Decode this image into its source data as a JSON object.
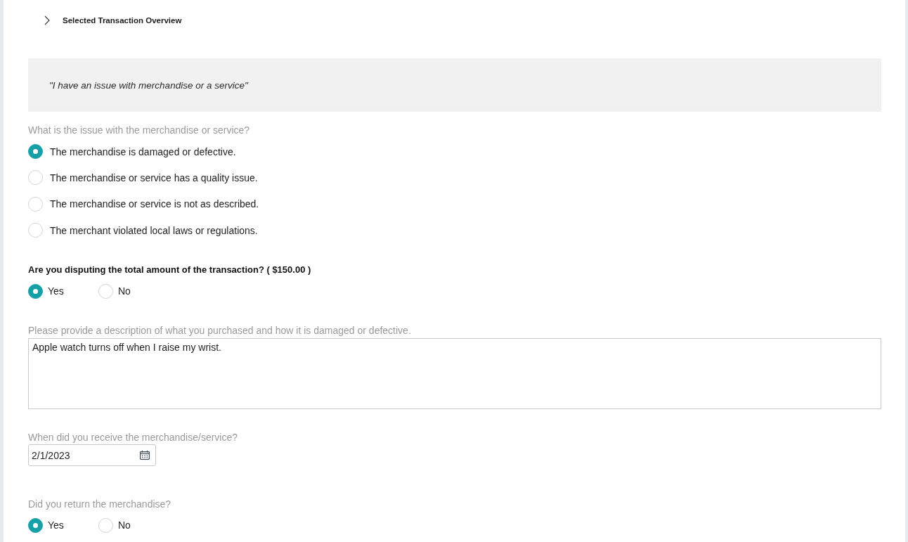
{
  "overview": {
    "title": "Selected Transaction Overview",
    "expanded": false
  },
  "claim_quote": "\"I have an issue with merchandise or a service\"",
  "questions": [
    {
      "kind": "radio_list",
      "label": "What is the issue with the merchandise or service?",
      "label_bold": false,
      "options": [
        {
          "label": "The merchandise is damaged or defective.",
          "selected": true
        },
        {
          "label": "The merchandise or service has a quality issue.",
          "selected": false
        },
        {
          "label": "The merchandise or service is not as described.",
          "selected": false
        },
        {
          "label": "The merchant violated local laws or regulations.",
          "selected": false
        }
      ]
    },
    {
      "kind": "radio_row",
      "label": "Are you disputing the total amount of the transaction? ( $150.00 )",
      "label_bold": true,
      "options": [
        {
          "label": "Yes",
          "selected": true
        },
        {
          "label": "No",
          "selected": false
        }
      ]
    },
    {
      "kind": "textarea",
      "label": "Please provide a description of what you purchased and how it is damaged or defective.",
      "label_bold": false,
      "value": "Apple watch turns off when I raise my wrist."
    },
    {
      "kind": "date",
      "label": "When did you receive the merchandise/service?",
      "label_bold": false,
      "value": "2/1/2023"
    },
    {
      "kind": "radio_row",
      "label": "Did you return the merchandise?",
      "label_bold": false,
      "options": [
        {
          "label": "Yes",
          "selected": true
        },
        {
          "label": "No",
          "selected": false
        }
      ]
    }
  ]
}
